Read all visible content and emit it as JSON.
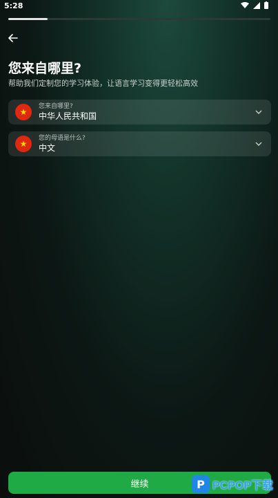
{
  "status_bar": {
    "time": "5:28"
  },
  "progress": {
    "fraction": 0.15
  },
  "page": {
    "title": "您来自哪里?",
    "subtitle": "帮助我们定制您的学习体验，让语言学习变得更轻松高效"
  },
  "fields": [
    {
      "label": "您来自哪里?",
      "value": "中华人民共和国",
      "icon": "china-flag-icon"
    },
    {
      "label": "您的母语是什么?",
      "value": "中文",
      "icon": "china-flag-icon"
    }
  ],
  "actions": {
    "continue_label": "继续"
  },
  "watermark": {
    "text": "PCPOP下载"
  },
  "colors": {
    "accent": "#1faa45",
    "flag_red": "#de2910",
    "flag_yellow": "#ffde00"
  }
}
